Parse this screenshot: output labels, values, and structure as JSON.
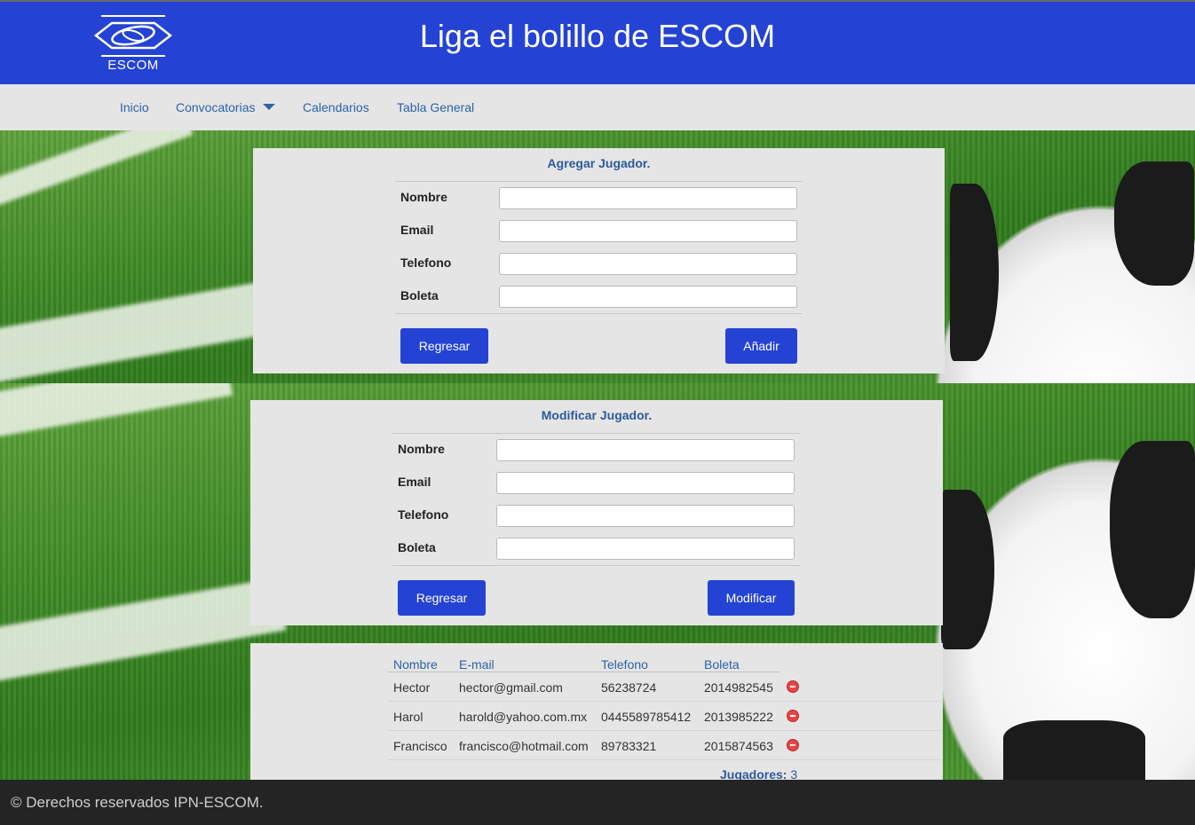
{
  "header": {
    "title": "Liga el bolillo de ESCOM",
    "logo_text": "ESCOM"
  },
  "nav": {
    "items": [
      "Inicio",
      "Convocatorias",
      "Calendarios",
      "Tabla General"
    ]
  },
  "add_form": {
    "title": "Agregar Jugador.",
    "fields": [
      "Nombre",
      "Email",
      "Telefono",
      "Boleta"
    ],
    "back_label": "Regresar",
    "submit_label": "Añadir"
  },
  "edit_form": {
    "title": "Modificar Jugador.",
    "fields": [
      "Nombre",
      "Email",
      "Telefono",
      "Boleta"
    ],
    "back_label": "Regresar",
    "submit_label": "Modificar"
  },
  "table": {
    "headers": [
      "Nombre",
      "E-mail",
      "Telefono",
      "Boleta"
    ],
    "rows": [
      [
        "Hector",
        "hector@gmail.com",
        "56238724",
        "2014982545"
      ],
      [
        "Harol",
        "harold@yahoo.com.mx",
        "0445589785412",
        "2013985222"
      ],
      [
        "Francisco",
        "francisco@hotmail.com",
        "89783321",
        "2015874563"
      ]
    ],
    "count_label": "Jugadores:",
    "count_value": "3"
  },
  "footer": {
    "text": "© Derechos reservados IPN-ESCOM."
  },
  "colors": {
    "primary": "#2443d4",
    "link": "#2d63a8",
    "panel": "#e5e5e5",
    "footer": "#242424",
    "delete": "#e84545"
  },
  "icons": {
    "delete": "remove-circle-icon",
    "dropdown": "caret-down-icon"
  }
}
